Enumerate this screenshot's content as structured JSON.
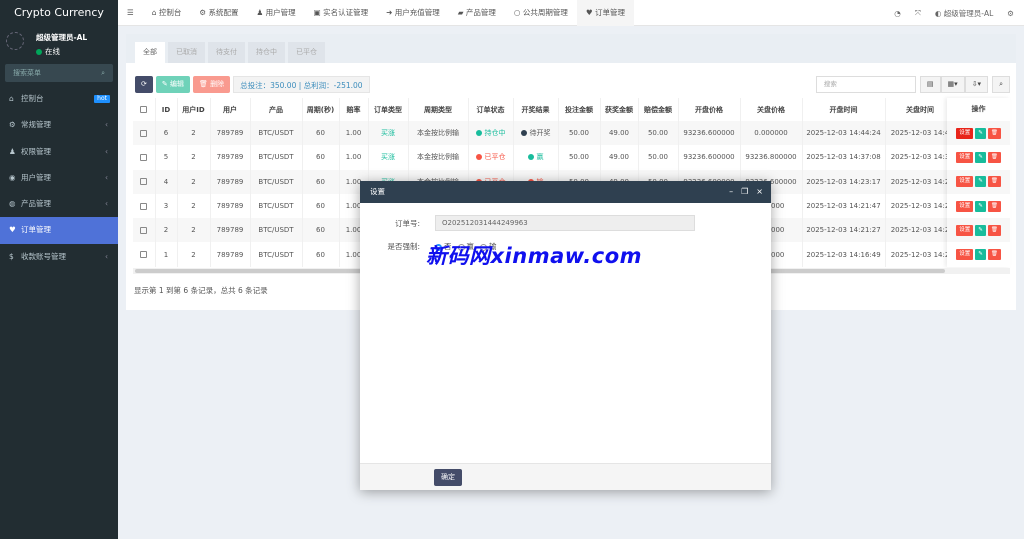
{
  "sidebar": {
    "brand": "Crypto Currency",
    "user": "超级管理员-AL",
    "status": "在线",
    "status_color": "#00a65a",
    "search_placeholder": "搜索菜单",
    "items": [
      {
        "label": "控制台",
        "icon": "dashboard-icon",
        "badge": "hot"
      },
      {
        "label": "常规管理",
        "icon": "cogs-icon"
      },
      {
        "label": "权限管理",
        "icon": "users-icon"
      },
      {
        "label": "用户管理",
        "icon": "user-circle-icon"
      },
      {
        "label": "产品管理",
        "icon": "product-icon"
      },
      {
        "label": "订单管理",
        "icon": "heartbeat-icon",
        "active": true
      },
      {
        "label": "收款账号管理",
        "icon": "bank-icon"
      }
    ]
  },
  "topnav": {
    "items": [
      {
        "label": "控制台",
        "icon": "dashboard-icon"
      },
      {
        "label": "系统配置",
        "icon": "gear-icon"
      },
      {
        "label": "用户管理",
        "icon": "user-icon"
      },
      {
        "label": "实名认证管理",
        "icon": "id-card-icon"
      },
      {
        "label": "用户充值管理",
        "icon": "sign-in-icon"
      },
      {
        "label": "产品管理",
        "icon": "shopping-bag-icon"
      },
      {
        "label": "公共周期管理",
        "icon": "circle-icon"
      },
      {
        "label": "订单管理",
        "icon": "heartbeat-icon",
        "active": true
      }
    ],
    "user": "超级管理员-AL"
  },
  "tabs": [
    "全部",
    "已取消",
    "待支付",
    "持仓中",
    "已平仓"
  ],
  "toolbar": {
    "edit": "编辑",
    "delete": "删除",
    "summary": "总投注：350.00 | 总利润：-251.00",
    "search_placeholder": "搜索"
  },
  "table": {
    "headers": [
      "ID",
      "用户ID",
      "用户",
      "产品",
      "周期(秒)",
      "赔率",
      "订单类型",
      "周期类型",
      "订单状态",
      "开奖结果",
      "投注金额",
      "获奖金额",
      "赔偿金额",
      "开盘价格",
      "关盘价格",
      "开盘时间",
      "关盘时间"
    ],
    "ops_header": "操作",
    "ops": {
      "set": "设置"
    },
    "rows": [
      [
        "6",
        "2",
        "789789",
        "BTC/USDT",
        "60",
        "1.00",
        "买涨",
        "本金按比例输",
        "持仓中",
        "待开奖",
        "50.00",
        "49.00",
        "50.00",
        "93236.600000",
        "0.000000",
        "2025-12-03 14:44:24",
        "2025-12-03 14:4"
      ],
      [
        "5",
        "2",
        "789789",
        "BTC/USDT",
        "60",
        "1.00",
        "买涨",
        "本金按比例输",
        "已平仓",
        "赢",
        "50.00",
        "49.00",
        "50.00",
        "93236.600000",
        "93236.800000",
        "2025-12-03 14:37:08",
        "2025-12-03 14:3"
      ],
      [
        "4",
        "2",
        "789789",
        "BTC/USDT",
        "60",
        "1.00",
        "买涨",
        "本金按比例输",
        "已平仓",
        "输",
        "50.00",
        "49.00",
        "50.00",
        "93236.600000",
        "93236.600000",
        "2025-12-03 14:23:17",
        "2025-12-03 14:2"
      ],
      [
        "3",
        "2",
        "789789",
        "BTC/USDT",
        "60",
        "1.00",
        "",
        "",
        "",
        "",
        "",
        "",
        "",
        "",
        "600000",
        "2025-12-03 14:21:47",
        "2025-12-03 14:2"
      ],
      [
        "2",
        "2",
        "789789",
        "BTC/USDT",
        "60",
        "1.00",
        "",
        "",
        "",
        "",
        "",
        "",
        "",
        "",
        "600000",
        "2025-12-03 14:21:27",
        "2025-12-03 14:2"
      ],
      [
        "1",
        "2",
        "789789",
        "BTC/USDT",
        "60",
        "1.00",
        "",
        "",
        "",
        "",
        "",
        "",
        "",
        "",
        "600000",
        "2025-12-03 14:16:49",
        "2025-12-03 14:2"
      ]
    ],
    "status_colors": {
      "持仓中": "#18bc9c",
      "已平仓": "#f75444",
      "待开奖": "#2f4050",
      "赢": "#18bc9c",
      "输": "#f75444"
    }
  },
  "footer": "显示第 1 到第 6 条记录，总共 6 条记录",
  "modal": {
    "title": "设置",
    "order_label": "订单号:",
    "order_value": "O202512031444249963",
    "force_label": "是否强制:",
    "options": [
      "否",
      "赢",
      "输"
    ],
    "selected": "否",
    "confirm": "确定"
  },
  "watermark": "新码网xinmaw.com"
}
